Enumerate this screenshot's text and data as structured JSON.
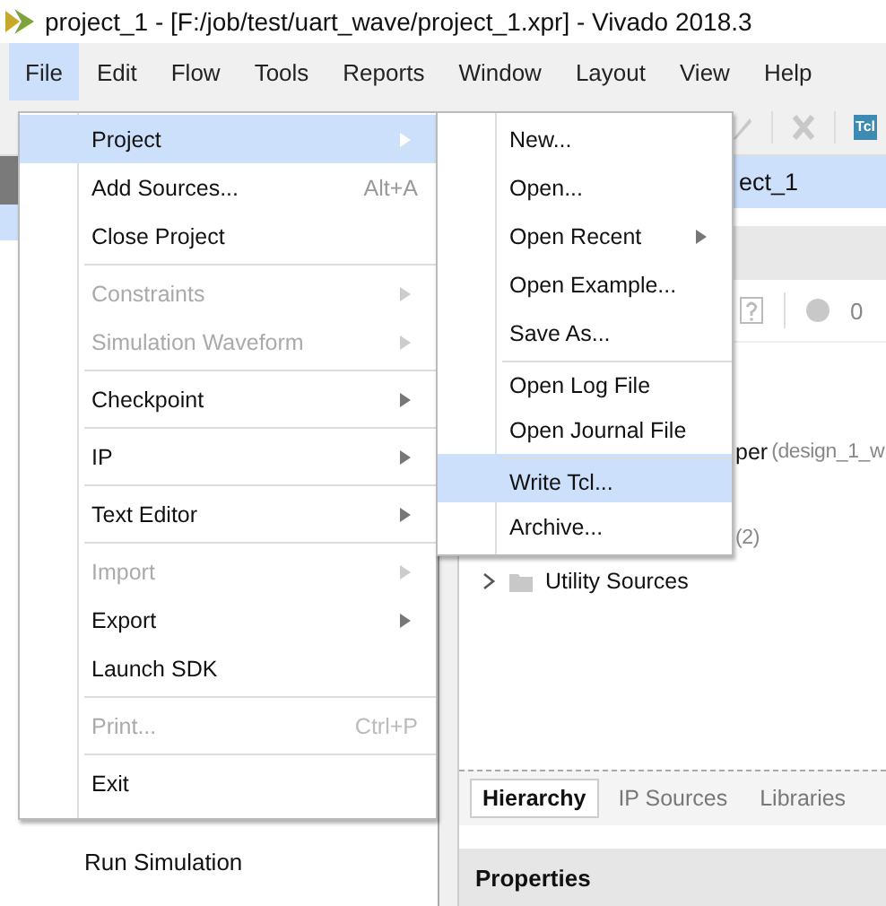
{
  "window": {
    "title": "project_1 - [F:/job/test/uart_wave/project_1.xpr] - Vivado 2018.3"
  },
  "menubar": [
    {
      "label": "File",
      "selected": true
    },
    {
      "label": "Edit",
      "selected": false
    },
    {
      "label": "Flow",
      "selected": false
    },
    {
      "label": "Tools",
      "selected": false
    },
    {
      "label": "Reports",
      "selected": false
    },
    {
      "label": "Window",
      "selected": false
    },
    {
      "label": "Layout",
      "selected": false
    },
    {
      "label": "View",
      "selected": false
    },
    {
      "label": "Help",
      "selected": false
    }
  ],
  "file_menu": [
    {
      "label": "Project",
      "submenu": true,
      "disabled": false,
      "selected": true,
      "separator_before": false
    },
    {
      "label": "Add Sources...",
      "shortcut": "Alt+A",
      "submenu": false,
      "disabled": false,
      "selected": false,
      "separator_before": false
    },
    {
      "label": "Close Project",
      "submenu": false,
      "disabled": false,
      "selected": false,
      "separator_before": false
    },
    {
      "label": "Constraints",
      "submenu": true,
      "disabled": true,
      "selected": false,
      "separator_before": true
    },
    {
      "label": "Simulation Waveform",
      "submenu": true,
      "disabled": true,
      "selected": false,
      "separator_before": false
    },
    {
      "label": "Checkpoint",
      "submenu": true,
      "disabled": false,
      "selected": false,
      "separator_before": true
    },
    {
      "label": "IP",
      "submenu": true,
      "disabled": false,
      "selected": false,
      "separator_before": true
    },
    {
      "label": "Text Editor",
      "submenu": true,
      "disabled": false,
      "selected": false,
      "separator_before": true
    },
    {
      "label": "Import",
      "submenu": true,
      "disabled": true,
      "selected": false,
      "separator_before": true
    },
    {
      "label": "Export",
      "submenu": true,
      "disabled": false,
      "selected": false,
      "separator_before": false
    },
    {
      "label": "Launch SDK",
      "submenu": false,
      "disabled": false,
      "selected": false,
      "separator_before": false
    },
    {
      "label": "Print...",
      "shortcut": "Ctrl+P",
      "submenu": false,
      "disabled": true,
      "selected": false,
      "separator_before": true
    },
    {
      "label": "Exit",
      "submenu": false,
      "disabled": false,
      "selected": false,
      "separator_before": true
    }
  ],
  "project_submenu": [
    {
      "label": "New...",
      "submenu": false,
      "selected": false,
      "separator_before": false
    },
    {
      "label": "Open...",
      "submenu": false,
      "selected": false,
      "separator_before": false
    },
    {
      "label": "Open Recent",
      "submenu": true,
      "selected": false,
      "separator_before": false
    },
    {
      "label": "Open Example...",
      "submenu": false,
      "selected": false,
      "separator_before": false
    },
    {
      "label": "Save As...",
      "submenu": false,
      "selected": false,
      "separator_before": false
    },
    {
      "label": "Open Log File",
      "submenu": false,
      "selected": false,
      "separator_before": true
    },
    {
      "label": "Open Journal File",
      "submenu": false,
      "selected": false,
      "separator_before": false
    },
    {
      "label": "Write Tcl...",
      "submenu": false,
      "selected": true,
      "separator_before": true
    },
    {
      "label": "Archive...",
      "submenu": false,
      "selected": false,
      "separator_before": false
    }
  ],
  "toolbar": {
    "tcl_label": "Tcl"
  },
  "flow_navigator": {
    "items": [
      "Run Simulation"
    ]
  },
  "sources": {
    "project_row": "ect_1",
    "message_count": "0",
    "tree": [
      {
        "label": "per",
        "note": "(design_1_w"
      },
      {
        "note": "(2)"
      }
    ],
    "utility_row": "Utility Sources",
    "tabs": [
      {
        "label": "Hierarchy",
        "selected": true
      },
      {
        "label": "IP Sources",
        "selected": false
      },
      {
        "label": "Libraries",
        "selected": false
      }
    ]
  },
  "properties": {
    "title": "Properties"
  }
}
